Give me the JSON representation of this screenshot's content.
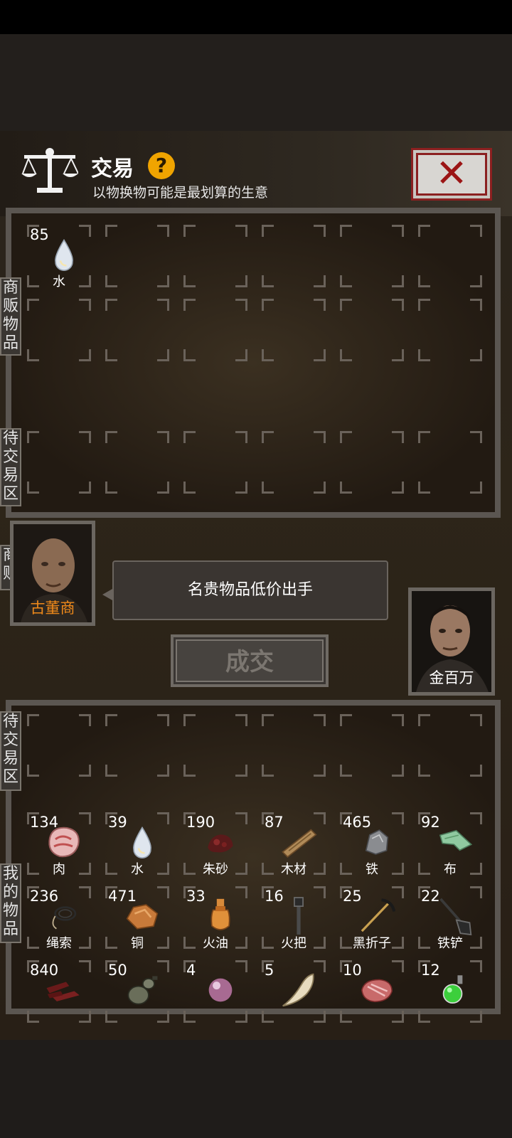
{
  "header": {
    "title": "交易",
    "help_label": "?",
    "subtitle": "以物换物可能是最划算的生意",
    "close_label": "✕"
  },
  "merchant_panel": {
    "label": "商贩物品",
    "items": [
      {
        "count": "85",
        "name": "水",
        "icon": "water-drop"
      }
    ]
  },
  "merchant_pending": {
    "label": "待交易区"
  },
  "merchant": {
    "label": "商贩",
    "name": "古董商",
    "name_color": "#f08a1a"
  },
  "speech": "名贵物品低价出手",
  "deal_button": "成交",
  "player": {
    "name": "金百万"
  },
  "player_pending": {
    "label": "待交易区"
  },
  "inventory": {
    "label": "我的物品",
    "items": [
      {
        "count": "134",
        "name": "肉",
        "icon": "meat"
      },
      {
        "count": "39",
        "name": "水",
        "icon": "water-drop"
      },
      {
        "count": "190",
        "name": "朱砂",
        "icon": "cinnabar"
      },
      {
        "count": "87",
        "name": "木材",
        "icon": "wood"
      },
      {
        "count": "465",
        "name": "铁",
        "icon": "iron-ore"
      },
      {
        "count": "92",
        "name": "布",
        "icon": "cloth"
      },
      {
        "count": "236",
        "name": "绳索",
        "icon": "rope"
      },
      {
        "count": "471",
        "name": "铜",
        "icon": "copper-ore"
      },
      {
        "count": "33",
        "name": "火油",
        "icon": "oil-flask"
      },
      {
        "count": "16",
        "name": "火把",
        "icon": "torch"
      },
      {
        "count": "25",
        "name": "黑折子",
        "icon": "pickaxe"
      },
      {
        "count": "22",
        "name": "铁铲",
        "icon": "shovel"
      },
      {
        "count": "840",
        "name": "",
        "icon": "jerky"
      },
      {
        "count": "50",
        "name": "",
        "icon": "gourd"
      },
      {
        "count": "4",
        "name": "",
        "icon": "pearl"
      },
      {
        "count": "5",
        "name": "",
        "icon": "tooth"
      },
      {
        "count": "10",
        "name": "",
        "icon": "raw-meat"
      },
      {
        "count": "12",
        "name": "",
        "icon": "green-potion"
      }
    ]
  }
}
